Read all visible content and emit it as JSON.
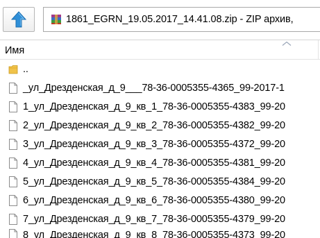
{
  "path_bar": {
    "up_button_icon": "up-arrow-icon",
    "archive_icon": "winrar-archive-icon",
    "path_text": "1861_EGRN_19.05.2017_14.41.08.zip - ZIP архив,"
  },
  "columns": {
    "name_label": "Имя",
    "sort_icon": "sort-ascending-icon"
  },
  "files": [
    {
      "name": "..",
      "icon": "folder-icon"
    },
    {
      "name": "_ул_Дрезденская_д_9___78-36-0005355-4365_99-2017-1",
      "icon": "file-icon"
    },
    {
      "name": "1_ул_Дрезденская_д_9_кв_1_78-36-0005355-4383_99-20",
      "icon": "file-icon"
    },
    {
      "name": "2_ул_Дрезденская_д_9_кв_2_78-36-0005355-4382_99-20",
      "icon": "file-icon"
    },
    {
      "name": "3_ул_Дрезденская_д_9_кв_3_78-36-0005355-4372_99-20",
      "icon": "file-icon"
    },
    {
      "name": "4_ул_Дрезденская_д_9_кв_4_78-36-0005355-4381_99-20",
      "icon": "file-icon"
    },
    {
      "name": "5_ул_Дрезденская_д_9_кв_5_78-36-0005355-4384_99-20",
      "icon": "file-icon"
    },
    {
      "name": "6_ул_Дрезденская_д_9_кв_6_78-36-0005355-4380_99-20",
      "icon": "file-icon"
    },
    {
      "name": "7_ул_Дрезденская_д_9_кв_7_78-36-0005355-4379_99-20",
      "icon": "file-icon"
    },
    {
      "name": "8_ул_Дрезденская_д_9_кв_8_78-36-0005355-4373_99-20",
      "icon": "file-icon"
    }
  ],
  "colors": {
    "up_arrow": "#2f8fd8",
    "folder": "#f0c34a",
    "border": "#a9a9a9"
  }
}
